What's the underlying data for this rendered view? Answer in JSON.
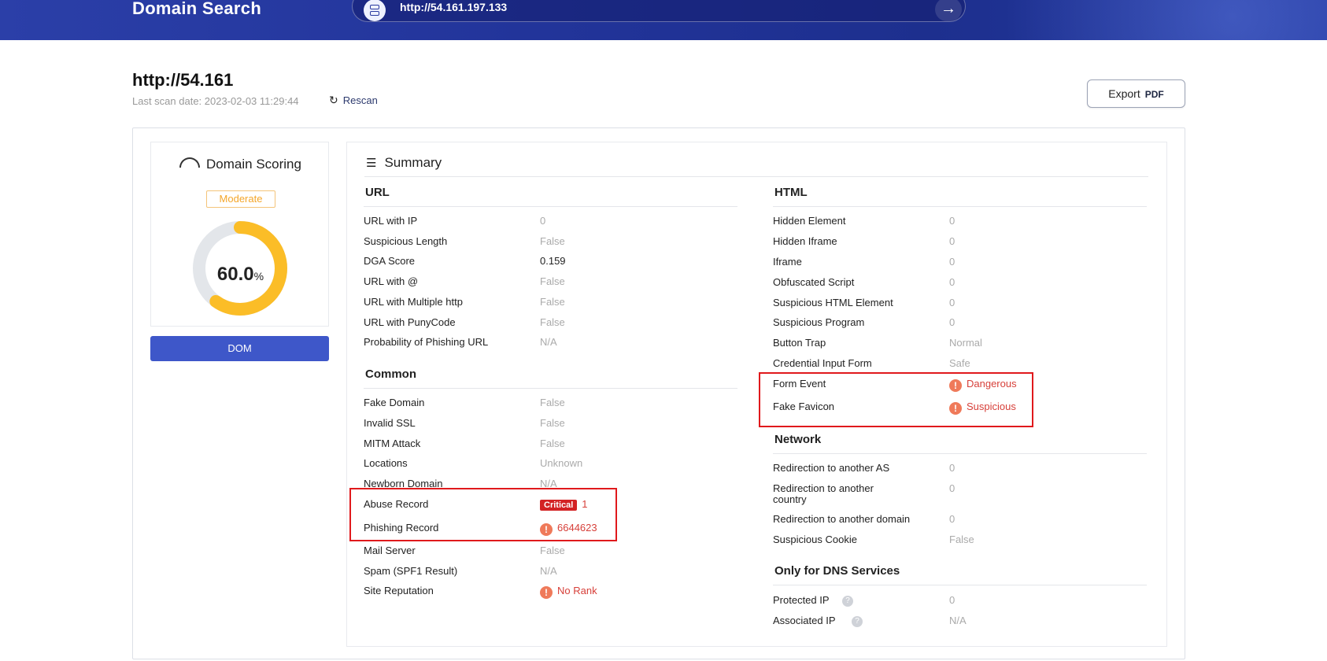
{
  "header": {
    "brand": "Domain Search",
    "url_value": "http://54.161.197.133",
    "go_icon": "arrow-right-icon"
  },
  "page": {
    "title": "http://54.161",
    "last_scan": "Last scan date: 2023-02-03 11:29:44",
    "rescan_label": "Rescan",
    "export_label": "Export",
    "export_format": "PDF"
  },
  "scoring": {
    "title": "Domain Scoring",
    "level": "Moderate",
    "score": "60.0",
    "unit": "%",
    "score_fraction": 0.6,
    "ring_color": "#fbbd27",
    "track_color": "#e3e6ea",
    "dom_label": "DOM"
  },
  "summary": {
    "title": "Summary",
    "url": {
      "title": "URL",
      "rows": [
        {
          "label": "URL with IP",
          "value": "0"
        },
        {
          "label": "Suspicious Length",
          "value": "False"
        },
        {
          "label": "DGA Score",
          "value": "0.159"
        },
        {
          "label": "URL with @",
          "value": "False"
        },
        {
          "label": "URL with Multiple http",
          "value": "False"
        },
        {
          "label": "URL with PunyCode",
          "value": "False"
        },
        {
          "label": "Probability of Phishing URL",
          "value": "N/A"
        }
      ]
    },
    "common": {
      "title": "Common",
      "rows": [
        {
          "label": "Fake Domain",
          "value": "False"
        },
        {
          "label": "Invalid SSL",
          "value": "False"
        },
        {
          "label": "MITM Attack",
          "value": "False"
        },
        {
          "label": "Locations",
          "value": "Unknown"
        },
        {
          "label": "Newborn Domain",
          "value": "N/A"
        },
        {
          "label": "Abuse Record",
          "badge": "Critical",
          "value": "1"
        },
        {
          "label": "Phishing Record",
          "value": "6644623"
        },
        {
          "label": "Mail Server",
          "value": "False"
        },
        {
          "label": "Spam (SPF1 Result)",
          "value": "N/A"
        },
        {
          "label": "Site Reputation",
          "value": "No Rank"
        }
      ]
    },
    "html": {
      "title": "HTML",
      "rows": [
        {
          "label": "Hidden Element",
          "value": "0"
        },
        {
          "label": "Hidden Iframe",
          "value": "0"
        },
        {
          "label": "Iframe",
          "value": "0"
        },
        {
          "label": "Obfuscated Script",
          "value": "0"
        },
        {
          "label": "Suspicious HTML Element",
          "value": "0"
        },
        {
          "label": "Suspicious Program",
          "value": "0"
        },
        {
          "label": "Button Trap",
          "value": "Normal"
        },
        {
          "label": "Credential Input Form",
          "value": "Safe"
        },
        {
          "label": "Form Event",
          "value": "Dangerous"
        },
        {
          "label": "Fake Favicon",
          "value": "Suspicious"
        }
      ]
    },
    "network": {
      "title": "Network",
      "rows": [
        {
          "label": "Redirection to another AS",
          "value": "0"
        },
        {
          "label": "Redirection to another",
          "label2": "country",
          "value": "0"
        },
        {
          "label": "Redirection to another domain",
          "value": "0"
        },
        {
          "label": "Suspicious Cookie",
          "value": "False"
        }
      ]
    },
    "dns": {
      "title": "Only for DNS Services",
      "rows": [
        {
          "label": "Protected IP",
          "value": "0"
        },
        {
          "label": "Associated IP",
          "value": "N/A"
        }
      ]
    }
  }
}
